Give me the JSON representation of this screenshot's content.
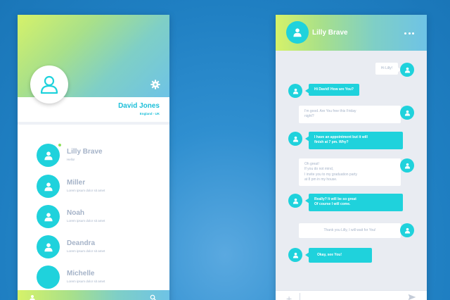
{
  "profile": {
    "name": "David Jones",
    "location": "England - UK"
  },
  "contacts": [
    {
      "name": "Lilly Brave",
      "preview": "Hello!",
      "online": true,
      "has_icon": true
    },
    {
      "name": "Miller",
      "preview": "Lorem ipsum dolor sit amet",
      "online": false,
      "has_icon": true
    },
    {
      "name": "Noah",
      "preview": "Lorem ipsum dolor sit amet",
      "online": false,
      "has_icon": true
    },
    {
      "name": "Deandra",
      "preview": "Lorem ipsum dolor sit amet",
      "online": false,
      "has_icon": true
    },
    {
      "name": "Michelle",
      "preview": "Lorem ipsum dolor sit amet",
      "online": false,
      "has_icon": false
    }
  ],
  "chat": {
    "contact_name": "Lilly Brave",
    "messages": [
      {
        "from": "me",
        "text": "Hi Lilly!"
      },
      {
        "from": "them",
        "text": "Hi David! How are You?"
      },
      {
        "from": "me",
        "text": "I'm good. Are You free this Friday\nnight?"
      },
      {
        "from": "them",
        "text": "I have an appointment but it will\nfinish at 7 pm. Why?"
      },
      {
        "from": "me",
        "text": "Oh great!\nIf you do not mind,\nI invite you to my graduation party\nat 8 pm in my house."
      },
      {
        "from": "them",
        "text": "Really? It will be so great\nOf course I will come."
      },
      {
        "from": "me",
        "text": "Thank you Lilly, I will wait for You!"
      },
      {
        "from": "them",
        "text": "Okay, see You!"
      }
    ]
  },
  "colors": {
    "accent": "#1fd2dc",
    "name_text": "#1cbfd9",
    "muted_text": "#a5b3c8",
    "online": "#8ee05a",
    "background": "#2f8fd0"
  },
  "icons": {
    "avatar": "user-icon",
    "settings": "gear-icon",
    "menu": "more-icon",
    "search": "search-icon",
    "attach": "plus-icon",
    "send": "send-icon"
  }
}
